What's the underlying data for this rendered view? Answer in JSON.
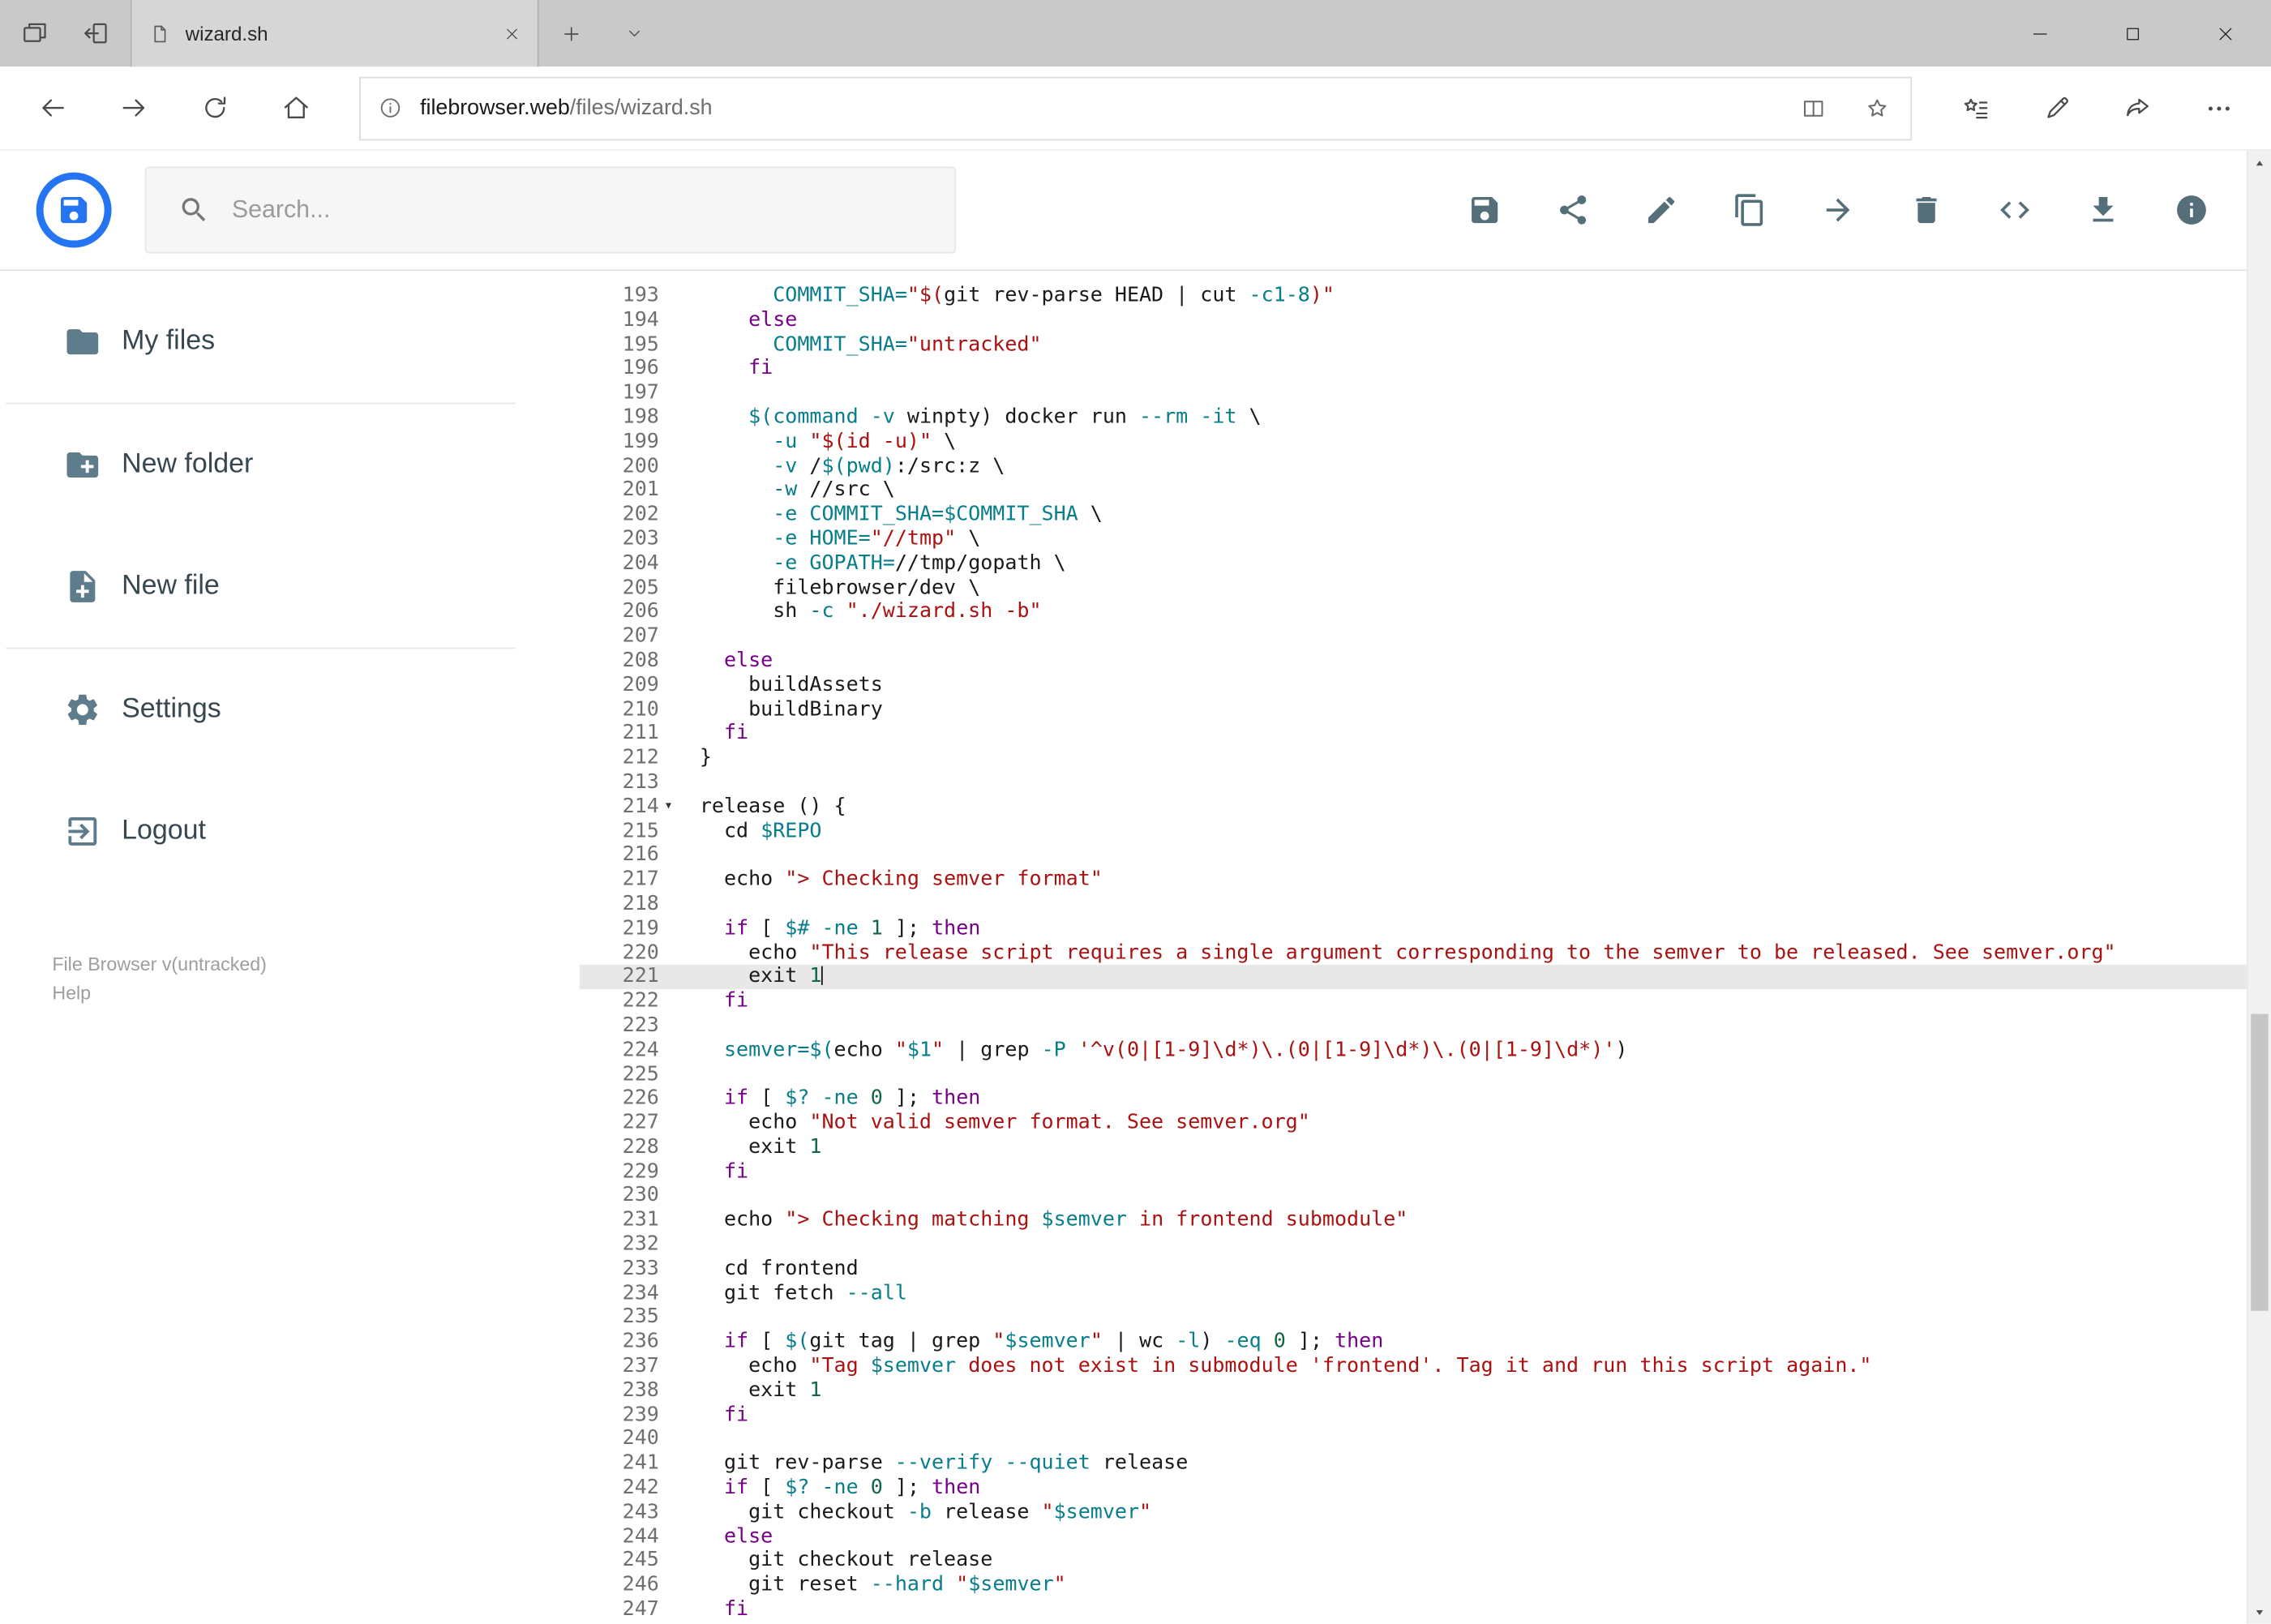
{
  "browser": {
    "tab_title": "wizard.sh",
    "url_domain": "filebrowser.web",
    "url_path": "/files/wizard.sh"
  },
  "search": {
    "placeholder": "Search..."
  },
  "toolbar": {
    "icons": [
      "save-icon",
      "share-icon",
      "edit-icon",
      "copy-icon",
      "move-icon",
      "delete-icon",
      "code-icon",
      "download-icon",
      "info-icon"
    ]
  },
  "sidebar": {
    "items": [
      {
        "id": "my-files",
        "icon": "folder-icon",
        "label": "My files"
      },
      {
        "id": "new-folder",
        "icon": "new-folder-icon",
        "label": "New folder"
      },
      {
        "id": "new-file",
        "icon": "new-file-icon",
        "label": "New file"
      },
      {
        "id": "settings",
        "icon": "settings-icon",
        "label": "Settings"
      },
      {
        "id": "logout",
        "icon": "logout-icon",
        "label": "Logout"
      }
    ],
    "dividers_after": [
      0,
      2
    ],
    "footer": {
      "version": "File Browser v(untracked)",
      "help": "Help"
    }
  },
  "colors": {
    "brand_blue": "#2575f2",
    "icon_gray": "#546e7a"
  },
  "editor": {
    "first_line": 193,
    "last_line": 247,
    "active_line": 221,
    "token_colors": {
      "pl": "#1a1a1a",
      "kw": "#770088",
      "str": "#aa1111",
      "var": "#087d8c",
      "attr": "#087d8c",
      "num": "#116644"
    },
    "lines": [
      {
        "n": 193,
        "segs": [
          [
            "pl",
            "      "
          ],
          [
            "var",
            "COMMIT_SHA="
          ],
          [
            "str",
            "\"$("
          ],
          [
            "pl",
            "git rev-parse HEAD | cut "
          ],
          [
            "attr",
            "-c1-8"
          ],
          [
            "str",
            ")\""
          ]
        ]
      },
      {
        "n": 194,
        "segs": [
          [
            "pl",
            "    "
          ],
          [
            "kw",
            "else"
          ]
        ]
      },
      {
        "n": 195,
        "segs": [
          [
            "pl",
            "      "
          ],
          [
            "var",
            "COMMIT_SHA="
          ],
          [
            "str",
            "\"untracked\""
          ]
        ]
      },
      {
        "n": 196,
        "segs": [
          [
            "pl",
            "    "
          ],
          [
            "kw",
            "fi"
          ]
        ]
      },
      {
        "n": 197,
        "segs": []
      },
      {
        "n": 198,
        "segs": [
          [
            "pl",
            "    "
          ],
          [
            "var",
            "$(command"
          ],
          [
            "pl",
            " "
          ],
          [
            "attr",
            "-v"
          ],
          [
            "pl",
            " winpty) docker run "
          ],
          [
            "attr",
            "--rm"
          ],
          [
            "pl",
            " "
          ],
          [
            "attr",
            "-it"
          ],
          [
            "pl",
            " \\"
          ]
        ]
      },
      {
        "n": 199,
        "segs": [
          [
            "pl",
            "      "
          ],
          [
            "attr",
            "-u"
          ],
          [
            "pl",
            " "
          ],
          [
            "str",
            "\"$(id -u)\""
          ],
          [
            "pl",
            " \\"
          ]
        ]
      },
      {
        "n": 200,
        "segs": [
          [
            "pl",
            "      "
          ],
          [
            "attr",
            "-v"
          ],
          [
            "pl",
            " /"
          ],
          [
            "var",
            "$(pwd)"
          ],
          [
            "pl",
            ":/src:z \\"
          ]
        ]
      },
      {
        "n": 201,
        "segs": [
          [
            "pl",
            "      "
          ],
          [
            "attr",
            "-w"
          ],
          [
            "pl",
            " //src \\"
          ]
        ]
      },
      {
        "n": 202,
        "segs": [
          [
            "pl",
            "      "
          ],
          [
            "attr",
            "-e"
          ],
          [
            "pl",
            " "
          ],
          [
            "var",
            "COMMIT_SHA=$COMMIT_SHA"
          ],
          [
            "pl",
            " \\"
          ]
        ]
      },
      {
        "n": 203,
        "segs": [
          [
            "pl",
            "      "
          ],
          [
            "attr",
            "-e"
          ],
          [
            "pl",
            " "
          ],
          [
            "var",
            "HOME="
          ],
          [
            "str",
            "\"//tmp\""
          ],
          [
            "pl",
            " \\"
          ]
        ]
      },
      {
        "n": 204,
        "segs": [
          [
            "pl",
            "      "
          ],
          [
            "attr",
            "-e"
          ],
          [
            "pl",
            " "
          ],
          [
            "var",
            "GOPATH="
          ],
          [
            "pl",
            "//tmp/gopath \\"
          ]
        ]
      },
      {
        "n": 205,
        "segs": [
          [
            "pl",
            "      filebrowser/dev \\"
          ]
        ]
      },
      {
        "n": 206,
        "segs": [
          [
            "pl",
            "      sh "
          ],
          [
            "attr",
            "-c"
          ],
          [
            "pl",
            " "
          ],
          [
            "str",
            "\"./wizard.sh -b\""
          ]
        ]
      },
      {
        "n": 207,
        "segs": []
      },
      {
        "n": 208,
        "segs": [
          [
            "pl",
            "  "
          ],
          [
            "kw",
            "else"
          ]
        ]
      },
      {
        "n": 209,
        "segs": [
          [
            "pl",
            "    buildAssets"
          ]
        ]
      },
      {
        "n": 210,
        "segs": [
          [
            "pl",
            "    buildBinary"
          ]
        ]
      },
      {
        "n": 211,
        "segs": [
          [
            "pl",
            "  "
          ],
          [
            "kw",
            "fi"
          ]
        ]
      },
      {
        "n": 212,
        "segs": [
          [
            "pl",
            "}"
          ]
        ]
      },
      {
        "n": 213,
        "segs": []
      },
      {
        "n": 214,
        "fold": true,
        "segs": [
          [
            "pl",
            "release () {"
          ]
        ]
      },
      {
        "n": 215,
        "segs": [
          [
            "pl",
            "  cd "
          ],
          [
            "var",
            "$REPO"
          ]
        ]
      },
      {
        "n": 216,
        "segs": []
      },
      {
        "n": 217,
        "segs": [
          [
            "pl",
            "  echo "
          ],
          [
            "str",
            "\"> Checking semver format\""
          ]
        ]
      },
      {
        "n": 218,
        "segs": []
      },
      {
        "n": 219,
        "segs": [
          [
            "pl",
            "  "
          ],
          [
            "kw",
            "if"
          ],
          [
            "pl",
            " [ "
          ],
          [
            "var",
            "$#"
          ],
          [
            "pl",
            " "
          ],
          [
            "attr",
            "-ne"
          ],
          [
            "pl",
            " "
          ],
          [
            "num",
            "1"
          ],
          [
            "pl",
            " ]; "
          ],
          [
            "kw",
            "then"
          ]
        ]
      },
      {
        "n": 220,
        "segs": [
          [
            "pl",
            "    echo "
          ],
          [
            "str",
            "\"This release script requires a single argument corresponding to the semver to be released. See semver.org\""
          ]
        ]
      },
      {
        "n": 221,
        "segs": [
          [
            "pl",
            "    exit "
          ],
          [
            "num",
            "1"
          ]
        ]
      },
      {
        "n": 222,
        "segs": [
          [
            "pl",
            "  "
          ],
          [
            "kw",
            "fi"
          ]
        ]
      },
      {
        "n": 223,
        "segs": []
      },
      {
        "n": 224,
        "segs": [
          [
            "pl",
            "  "
          ],
          [
            "var",
            "semver=$("
          ],
          [
            "pl",
            "echo "
          ],
          [
            "str",
            "\""
          ],
          [
            "var",
            "$1"
          ],
          [
            "str",
            "\""
          ],
          [
            "pl",
            " | grep "
          ],
          [
            "attr",
            "-P"
          ],
          [
            "pl",
            " "
          ],
          [
            "str",
            "'^v(0|[1-9]\\d*)\\.(0|[1-9]\\d*)\\.(0|[1-9]\\d*)'"
          ],
          [
            "pl",
            ")"
          ]
        ]
      },
      {
        "n": 225,
        "segs": []
      },
      {
        "n": 226,
        "segs": [
          [
            "pl",
            "  "
          ],
          [
            "kw",
            "if"
          ],
          [
            "pl",
            " [ "
          ],
          [
            "var",
            "$?"
          ],
          [
            "pl",
            " "
          ],
          [
            "attr",
            "-ne"
          ],
          [
            "pl",
            " "
          ],
          [
            "num",
            "0"
          ],
          [
            "pl",
            " ]; "
          ],
          [
            "kw",
            "then"
          ]
        ]
      },
      {
        "n": 227,
        "segs": [
          [
            "pl",
            "    echo "
          ],
          [
            "str",
            "\"Not valid semver format. See semver.org\""
          ]
        ]
      },
      {
        "n": 228,
        "segs": [
          [
            "pl",
            "    exit "
          ],
          [
            "num",
            "1"
          ]
        ]
      },
      {
        "n": 229,
        "segs": [
          [
            "pl",
            "  "
          ],
          [
            "kw",
            "fi"
          ]
        ]
      },
      {
        "n": 230,
        "segs": []
      },
      {
        "n": 231,
        "segs": [
          [
            "pl",
            "  echo "
          ],
          [
            "str",
            "\"> Checking matching "
          ],
          [
            "var",
            "$semver"
          ],
          [
            "str",
            " in frontend submodule\""
          ]
        ]
      },
      {
        "n": 232,
        "segs": []
      },
      {
        "n": 233,
        "segs": [
          [
            "pl",
            "  cd frontend"
          ]
        ]
      },
      {
        "n": 234,
        "segs": [
          [
            "pl",
            "  git fetch "
          ],
          [
            "attr",
            "--all"
          ]
        ]
      },
      {
        "n": 235,
        "segs": []
      },
      {
        "n": 236,
        "segs": [
          [
            "pl",
            "  "
          ],
          [
            "kw",
            "if"
          ],
          [
            "pl",
            " [ "
          ],
          [
            "var",
            "$("
          ],
          [
            "pl",
            "git tag | grep "
          ],
          [
            "str",
            "\""
          ],
          [
            "var",
            "$semver"
          ],
          [
            "str",
            "\""
          ],
          [
            "pl",
            " | wc "
          ],
          [
            "attr",
            "-l"
          ],
          [
            "pl",
            ") "
          ],
          [
            "attr",
            "-eq"
          ],
          [
            "pl",
            " "
          ],
          [
            "num",
            "0"
          ],
          [
            "pl",
            " ]; "
          ],
          [
            "kw",
            "then"
          ]
        ]
      },
      {
        "n": 237,
        "segs": [
          [
            "pl",
            "    echo "
          ],
          [
            "str",
            "\"Tag "
          ],
          [
            "var",
            "$semver"
          ],
          [
            "str",
            " does not exist in submodule 'frontend'. Tag it and run this script again.\""
          ]
        ]
      },
      {
        "n": 238,
        "segs": [
          [
            "pl",
            "    exit "
          ],
          [
            "num",
            "1"
          ]
        ]
      },
      {
        "n": 239,
        "segs": [
          [
            "pl",
            "  "
          ],
          [
            "kw",
            "fi"
          ]
        ]
      },
      {
        "n": 240,
        "segs": []
      },
      {
        "n": 241,
        "segs": [
          [
            "pl",
            "  git rev-parse "
          ],
          [
            "attr",
            "--verify"
          ],
          [
            "pl",
            " "
          ],
          [
            "attr",
            "--quiet"
          ],
          [
            "pl",
            " release"
          ]
        ]
      },
      {
        "n": 242,
        "segs": [
          [
            "pl",
            "  "
          ],
          [
            "kw",
            "if"
          ],
          [
            "pl",
            " [ "
          ],
          [
            "var",
            "$?"
          ],
          [
            "pl",
            " "
          ],
          [
            "attr",
            "-ne"
          ],
          [
            "pl",
            " "
          ],
          [
            "num",
            "0"
          ],
          [
            "pl",
            " ]; "
          ],
          [
            "kw",
            "then"
          ]
        ]
      },
      {
        "n": 243,
        "segs": [
          [
            "pl",
            "    git checkout "
          ],
          [
            "attr",
            "-b"
          ],
          [
            "pl",
            " release "
          ],
          [
            "str",
            "\""
          ],
          [
            "var",
            "$semver"
          ],
          [
            "str",
            "\""
          ]
        ]
      },
      {
        "n": 244,
        "segs": [
          [
            "pl",
            "  "
          ],
          [
            "kw",
            "else"
          ]
        ]
      },
      {
        "n": 245,
        "segs": [
          [
            "pl",
            "    git checkout release"
          ]
        ]
      },
      {
        "n": 246,
        "segs": [
          [
            "pl",
            "    git reset "
          ],
          [
            "attr",
            "--hard"
          ],
          [
            "pl",
            " "
          ],
          [
            "str",
            "\""
          ],
          [
            "var",
            "$semver"
          ],
          [
            "str",
            "\""
          ]
        ]
      },
      {
        "n": 247,
        "segs": [
          [
            "pl",
            "  "
          ],
          [
            "kw",
            "fi"
          ]
        ]
      }
    ]
  }
}
